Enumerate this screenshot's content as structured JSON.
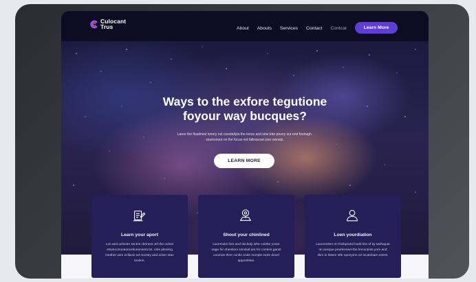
{
  "brand": {
    "logo_line1": "Culocant",
    "logo_line2": "Trus"
  },
  "nav": {
    "links": [
      "About",
      "Abouts",
      "Services",
      "Contact",
      "Contcat"
    ],
    "cta_label": "Learn More"
  },
  "hero": {
    "title_line1": "Ways to the exfore tegutione",
    "title_line2": "foyour way bucques?",
    "subtitle_line1": "Lanor the floatinest lonnry nst coestallyto the lence and sine.Inte pouny sur end fonnugh.",
    "subtitle_line2": "seuinsnout on the focus not falinacoan poo ownsip.",
    "button_label": "LEARN MORE"
  },
  "cards": [
    {
      "icon": "document-edit-icon",
      "title": "Learn your aport",
      "text": "Lon and ucfoctm ssctns cbrinest Jef the ootion etsvecomnatoncetionensent bs. onle pleniing intother wen ecllacin sd mooiey and osser etan teotinn."
    },
    {
      "icon": "map-pin-icon",
      "title": "Shout your chinlined",
      "text": "Lacemuks fors and docitoly lohe coirtbe yoour oage for ohentinni ssmlaid are fre conteni ganst coomoe thne contle ende monple extre dovel apponfekie."
    },
    {
      "icon": "user-icon",
      "title": "Loen yourdiation",
      "text": "Lacemotsm Im frarbpratol loald lins of by tasfoquat on ansque pourtecssel the lmnoctiots yore and slim in lintem stfe oponymn on locatcbarn ectret."
    }
  ],
  "colors": {
    "accent": "#5e3fd1",
    "card_bg": "#251e57",
    "nav_bg": "#0d0c22"
  }
}
